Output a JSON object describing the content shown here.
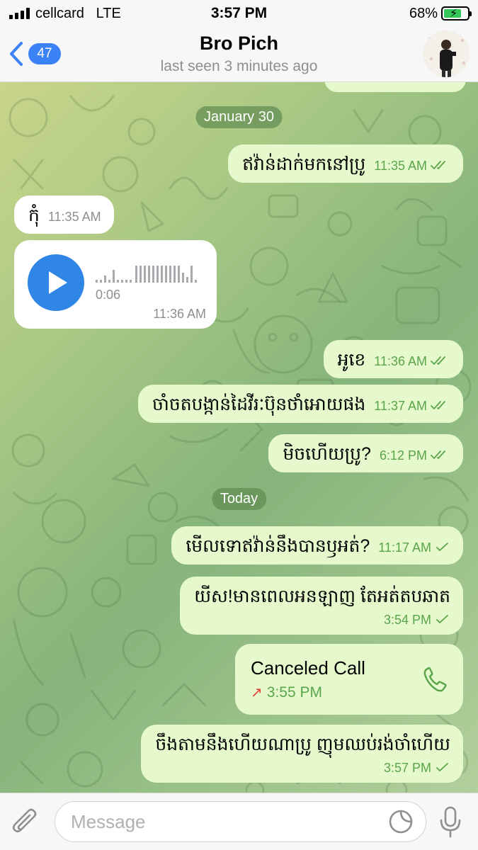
{
  "status_bar": {
    "carrier": "cellcard",
    "network": "LTE",
    "time": "3:57 PM",
    "battery": "68%"
  },
  "header": {
    "back_count": "47",
    "contact_name": "Bro Pich",
    "last_seen": "last seen 3 minutes ago"
  },
  "chat": {
    "date_1": "January 30",
    "date_2": "Today",
    "messages": [
      {
        "dir": "out",
        "text": "ឥវ៉ាន់ដាក់មកនៅប្រូ",
        "time": "11:35 AM",
        "status": "read"
      },
      {
        "dir": "in",
        "text": "កុំ",
        "time": "11:35 AM"
      },
      {
        "dir": "in",
        "type": "voice",
        "duration": "0:06",
        "time": "11:36 AM"
      },
      {
        "dir": "out",
        "text": "អូខេ",
        "time": "11:36 AM",
        "status": "read"
      },
      {
        "dir": "out",
        "text": "ចាំចតបង្កាន់ដៃវីរៈប៊ុនថាំអោយផង",
        "time": "11:37 AM",
        "status": "read"
      },
      {
        "dir": "out",
        "text": "មិចហើយប្រូ?",
        "time": "6:12 PM",
        "status": "read"
      },
      {
        "dir": "out",
        "text": "មើលទោឥវ៉ាន់នឹងបានឫអត់?",
        "time": "11:17 AM",
        "status": "sent"
      },
      {
        "dir": "out",
        "text": "យីស!មានពេលអនឡាញ តែអត់តបឆាត",
        "time": "3:54 PM",
        "status": "sent"
      },
      {
        "dir": "out",
        "type": "call",
        "title": "Canceled Call",
        "time": "3:55 PM"
      },
      {
        "dir": "out",
        "text": "ចឹងតាមនឹងហើយណាប្រូ ញុមឈប់រង់ចាំហើយ",
        "time": "3:57 PM",
        "status": "sent"
      }
    ]
  },
  "composer": {
    "placeholder": "Message"
  },
  "colors": {
    "accent": "#2f86e5",
    "outgoing_bubble": "#e5f9cd",
    "check": "#5aa54a",
    "missed_arrow": "#e4433b"
  },
  "icons": [
    "back-chevron-icon",
    "play-icon",
    "phone-icon",
    "missed-call-arrow-icon",
    "attach-icon",
    "sticker-icon",
    "mic-icon"
  ]
}
